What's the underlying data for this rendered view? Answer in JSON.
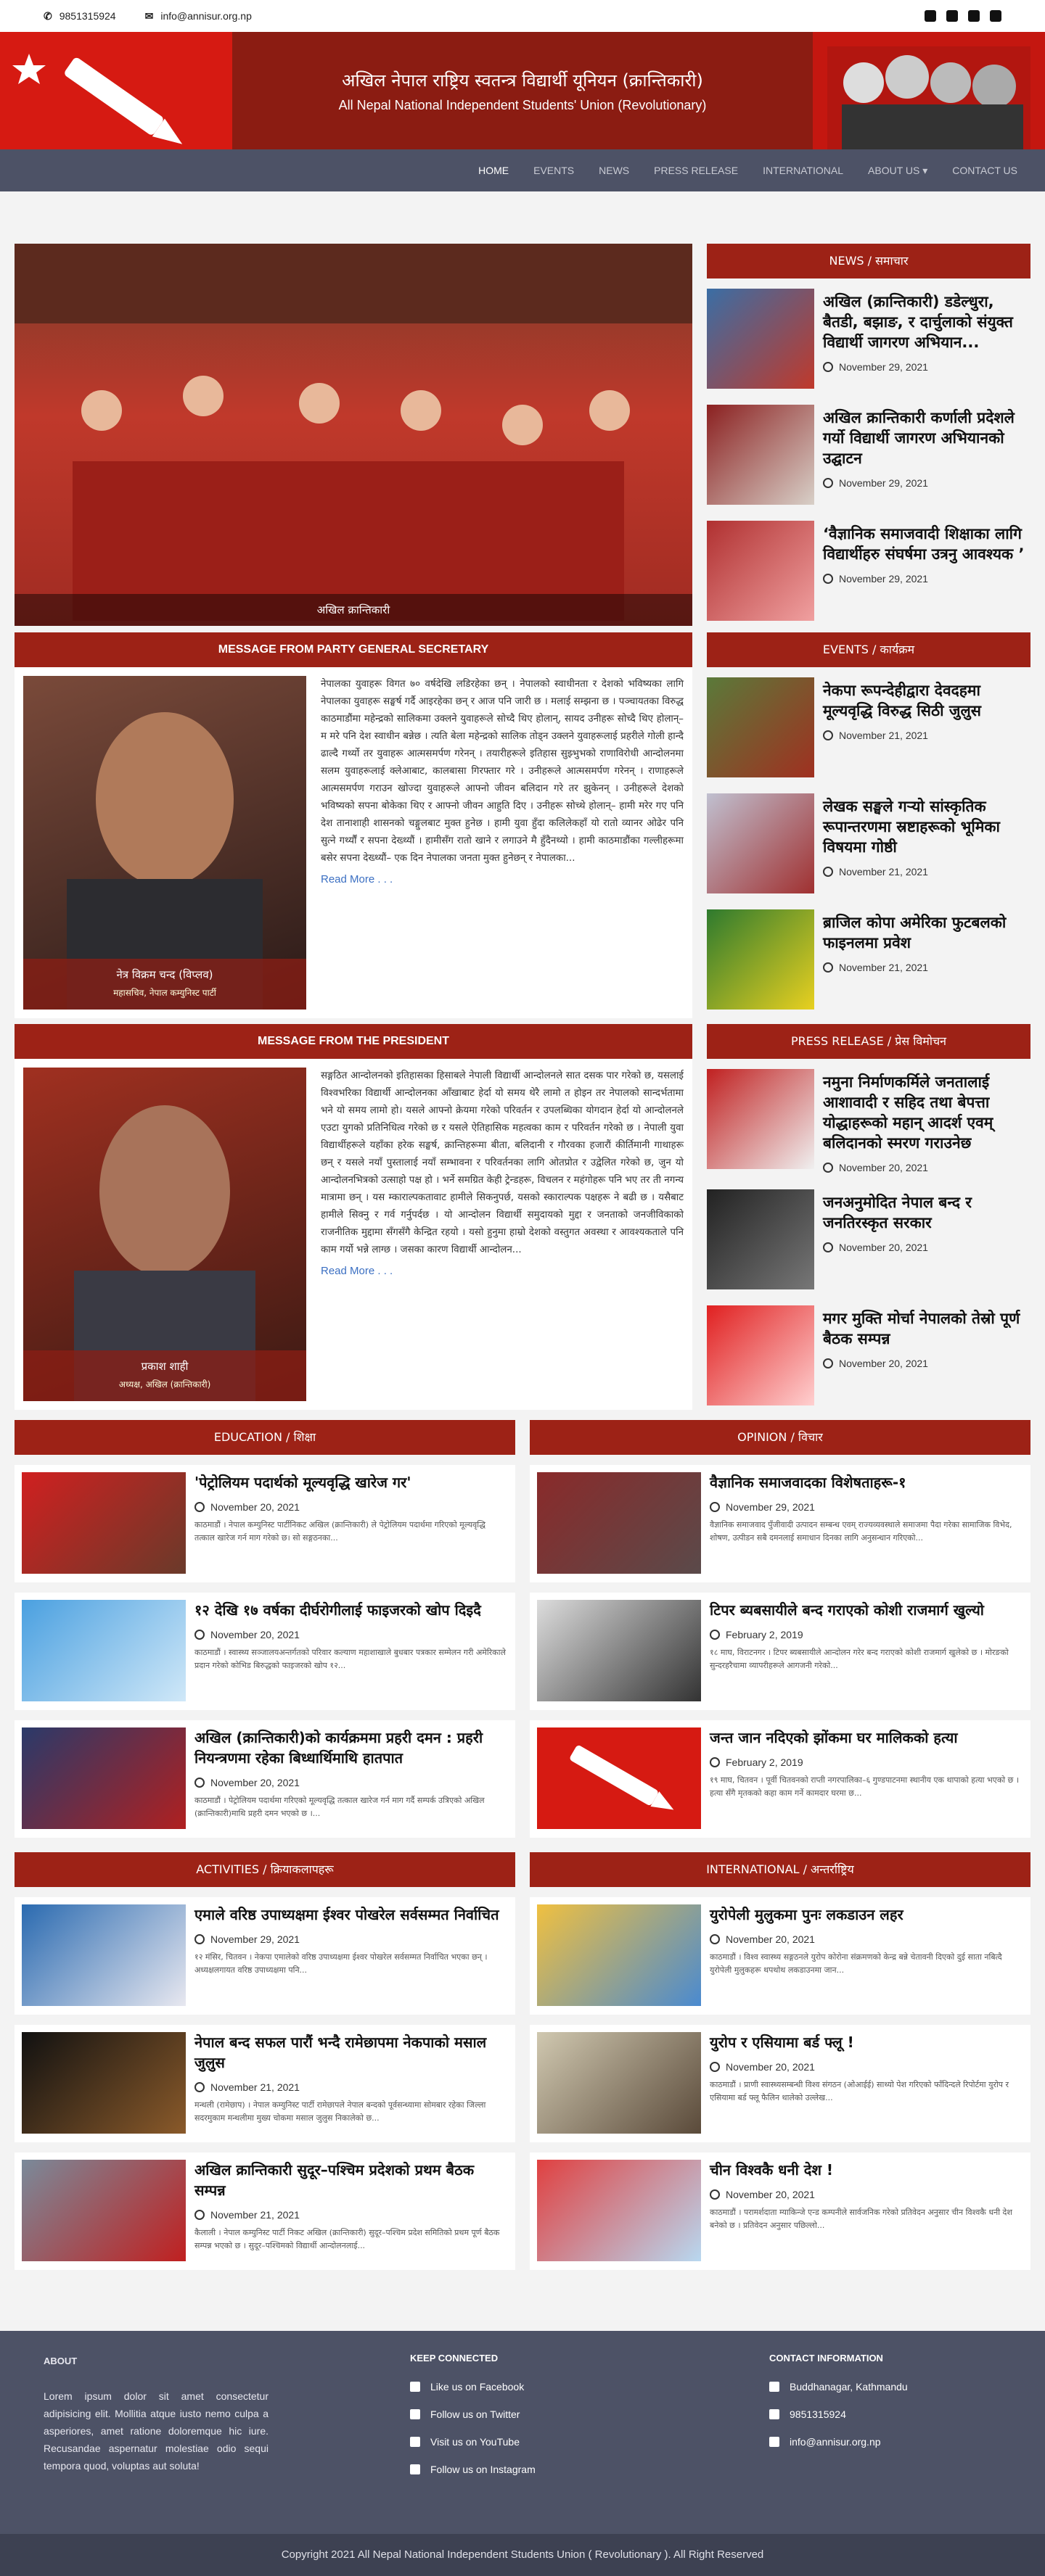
{
  "topbar": {
    "phone": "9851315924",
    "email": "info@annisur.org.np"
  },
  "header": {
    "title_np": "अखिल नेपाल राष्ट्रिय स्वतन्त्र विद्यार्थी यूनियन (क्रान्तिकारी)",
    "title_en": "All Nepal National Independent Students' Union (Revolutionary)"
  },
  "nav": [
    "HOME",
    "EVENTS",
    "NEWS",
    "PRESS RELEASE",
    "INTERNATIONAL",
    "ABOUT US ▾",
    "CONTACT US"
  ],
  "hero": {
    "caption": "अखिल क्रान्तिकारी"
  },
  "news": {
    "title": "NEWS / समाचार",
    "items": [
      {
        "title": "अखिल (क्रान्तिकारी) डडेल्धुरा, बैतडी, बझाङ, र दार्चुलाको संयुक्त विद्यार्थी जागरण अभियान...",
        "date": "November 29, 2021"
      },
      {
        "title": "अखिल क्रान्तिकारी कर्णाली प्रदेशले गर्यो विद्यार्थी जागरण अभियानको उद्घाटन",
        "date": "November 29, 2021"
      },
      {
        "title": "‘वैज्ञानिक समाजवादी शिक्षाका लागि विद्यार्थीहरु संघर्षमा उत्रनु आवश्यक ’",
        "date": "November 29, 2021"
      }
    ]
  },
  "events": {
    "title": "EVENTS / कार्यक्रम",
    "items": [
      {
        "title": "नेकपा रूपन्देहीद्वारा देवदहमा मूल्यवृद्धि विरुद्ध सिठी जुलुस",
        "date": "November 21, 2021"
      },
      {
        "title": "लेखक सङ्घले गर्‍यो सांस्कृतिक रूपान्तरणमा स्रष्टाहरूको भूमिका विषयमा गोष्ठी",
        "date": "November 21, 2021"
      },
      {
        "title": "ब्राजिल कोपा अमेरिका फुटबलको फाइनलमा प्रवेश",
        "date": "November 21, 2021"
      }
    ]
  },
  "press": {
    "title": "PRESS RELEASE / प्रेस विमोचन",
    "items": [
      {
        "title": "नमुना निर्माणकर्मिले जनतालाई आशावादी र सहिद तथा बेपत्ता योद्धाहरूको महान् आदर्श एवम् बलिदानको स्मरण गराउनेछ",
        "date": "November 20, 2021"
      },
      {
        "title": "जनअनुमोदित नेपाल बन्द र जनतिरस्कृत सरकार",
        "date": "November 20, 2021"
      },
      {
        "title": "मगर मुक्ति मोर्चा नेपालको तेस्रो पूर्ण बैठक सम्पन्न",
        "date": "November 20, 2021"
      }
    ]
  },
  "secretary": {
    "title": "MESSAGE FROM PARTY GENERAL SECRETARY",
    "name": "नेत्र विक्रम चन्द (विप्लव)",
    "role": "महासचिव, नेपाल कम्युनिस्ट पार्टी",
    "text": "नेपालका युवाहरू विगत ७० वर्षदेखि लडिरहेका छन् । नेपालको स्वाधीनता र देशको भविष्यका लागि नेपालका युवाहरू सङ्घर्ष गर्दै आइरहेका छन् र आज पनि जारी छ । मलाई सम्झना छ । पञ्चायतका विरुद्ध काठमाडौंमा महेन्द्रको सालिकमा उक्लने युवाहरूले सोच्दै थिए होलान्, सायद उनीहरू सोच्दै थिए होलान्– म मरे पनि देश स्वाधीन बन्नेछ । त्यति बेला महेन्द्रको सालिक तोड्न उक्लने युवाहरूलाई प्रहरीले गोली हान्दै ढाल्दै गर्थ्यो तर युवाहरू आत्मसमर्पण गरेनन् । तयारीहरूले इतिहास सुझ्भुभको राणाविरोधी आन्दोलनमा सलम युवाहरूलाई क्लेआबाट, कालबासा गिरफ्तार गरे । उनीहरूले आत्मसमर्पण गरेनन् । राणाहरूले आत्मसमर्पण गराउन खोज्दा युवाहरूले आफ्नो जीवन बलिदान गरे तर झुकेनन् । उनीहरूले देशको भविष्यको सपना बोकेका थिए र आफ्नो जीवन आहुति दिए । उनीहरू सोच्थे होलान्– हामी मरेर गए पनि देश तानाशाही शासनको चङ्गुलबाट मुक्त हुनेछ । हामी युवा हुँदा कलिलेकहाँ यो रातो व्यानर ओढेर पनि सुत्ने गर्थ्यौं र सपना देख्थ्यौं । हामीसँग रातो खाने र लगाउने मै हुँदैनथ्यो । हामी काठमाडौंका गल्लीहरूमा बसेर सपना देख्थ्यौं– एक दिन नेपालका जनता मुक्त हुनेछन् र नेपालका...",
    "readmore": "Read More . . ."
  },
  "president": {
    "title": "MESSAGE FROM THE PRESIDENT",
    "name": "प्रकाश शाही",
    "role": "अध्यक्ष, अखिल (क्रान्तिकारी)",
    "text": "सङ्गठित आन्दोलनको इतिहासका हिसाबले नेपाली विद्यार्थी आन्दोलनले सात दसक पार गरेको छ, यसलाई विश्वभरिका विद्यार्थी आन्दोलनका आँखाबाट हेर्दा यो समय थेरै लामो त होइन तर नेपालको सान्दर्भतामा भने यो समय लामो हो। यसले आफ्नो क्रेयमा गरेको परिवर्तन र उपलब्धिका योगदान हेर्दा यो आन्दोलनले एउटा युगको प्रतिनिधित्व गरेको छ र यसले ऐतिहासिक महत्वका काम र परिवर्तन गरेको छ । नेपाली युवा विद्यार्थीहरूले यहाँका हरेक सङ्घर्ष, क्रान्तिहरूमा बीता, बलिदानी र गौरवका हजारौं कीर्तिमानी गाथाहरू छन् र यसले नयाँ पुस्तालाई नयाँ सम्भावना र परिवर्तनका लागि ओतप्रोत र उद्वेलित गरेको छ, जुन यो आन्दोलनभित्रको उत्साहो पक्ष हो । भर्ने समग्रित केही ट्रेन्डहरू, विचलन र महंगोहरू पनि भए तर ती नगन्य मात्रामा छन् । यस म्काराल्पकतावाट हामीले सिकनुपर्छ, यसको स्काराल्पक पक्षहरू ने बढी छ । यसैबाट हामीले सिक्नु र गर्व गर्नुपर्दछ । यो आन्दोलन विद्यार्थी समुदायको मुद्दा र जनताको जनजीविकाको राजनीतिक मुद्दामा सँगसँगै केन्द्रित रहयो । यसो हुनुमा हाम्रो देशको वस्तुगत अवस्था र आवश्यकताले पनि काम गर्यो भन्ने लाग्छ । जसका कारण विद्यार्थी आन्दोलन...",
    "readmore": "Read More . . ."
  },
  "education": {
    "title": "EDUCATION / शिक्षा",
    "items": [
      {
        "title": "'पेट्रोलियम पदार्थको मूल्यवृद्धि खारेज गर'",
        "date": "November 20, 2021",
        "text": "काठमाडौं । नेपाल कम्युनिस्ट पार्टीनिकट अखिल (क्रान्तिकारी) ले पेट्रोलियम पदार्थमा गरिएको मूल्यवृद्धि तत्काल खारेज गर्न माग गरेको छ। सो सङ्गठनका..."
      },
      {
        "title": "१२ देखि १७ वर्षका दीर्घरोगीलाई फाइजरको खोप दिइदै",
        "date": "November 20, 2021",
        "text": "काठमाडौं । स्वास्थ्य सञ्जालयअन्तर्गतको परिवार कल्याण महाशाखाले बुधबार पत्रकार सम्मेलन गरी अमेरिकाले प्रदान गरेको कोभिड बिरुद्धको फाइजरको खोप १२..."
      },
      {
        "title": "अखिल (क्रान्तिकारी)को कार्यक्रममा प्रहरी दमन : प्रहरी नियन्त्रणमा रहेका बिध्धार्थिमाथि हातपात",
        "date": "November 20, 2021",
        "text": "काठमाडौं । पेट्रोलियम पदार्थमा गरिएको मूल्यवृद्धि तत्काल खारेज गर्न माग गर्दै सम्पर्क उत्रिएको अखिल (क्रान्तिकारी)माथि प्रहरी दमन भएको छ ।..."
      }
    ]
  },
  "opinion": {
    "title": "OPINION / विचार",
    "items": [
      {
        "title": "वैज्ञानिक समाजवादका विशेषताहरू-१",
        "date": "November 29, 2021",
        "text": "वैज्ञानिक समाजवाद पुँजीवादी उत्पादन सम्बन्ध एवम् राज्यव्यवस्थाले समाजमा पैदा गरेका सामाजिक विभेद, शोषण, उत्पीडन सबै दमनलाई समाधान दिनका लागि अनुसन्धान गरिएको..."
      },
      {
        "title": "टिपर ब्यबसायीले बन्द गराएको कोशी राजमार्ग खुल्यो",
        "date": "February 2, 2019",
        "text": "१८ माघ, विराटनगर । टिपर ब्यबसायीले आन्दोलन गरेर बन्द गराएको कोशी राजमार्ग खुलेको छ । मोरङको सुन्दरहरैचामा व्यापरीहरूले आगजनी गरेको..."
      },
      {
        "title": "जन्त जान नदिएको झोंकमा घर मालिकको हत्या",
        "date": "February 2, 2019",
        "text": "१९ माघ, चितवन । पूर्वी चितवनको राप्ती नगरपालिका–६ गुण्डपाटनमा स्थानीय एक थापाको हत्या भएको छ । हत्या सँगै मृतकको कहा काम गर्ने कामदार घरमा छ..."
      }
    ]
  },
  "activities": {
    "title": "ACTIVITIES / क्रियाकलापहरू",
    "items": [
      {
        "title": "एमाले वरिष्ठ उपाध्यक्षमा ईश्वर पोखरेल सर्वसम्मत निर्वाचित",
        "date": "November 29, 2021",
        "text": "१२ मंसिर, चितवन । नेकपा एमालेको वरिष्ठ उपाध्यक्षमा ईश्वर पोखरेल सर्वसम्मत निर्वाचित भएका छन् । अध्यक्षलगायत वरिष्ठ उपाध्यक्षमा पनि..."
      },
      {
        "title": "नेपाल बन्द सफल पारौं भन्दै रामेछापमा नेकपाको मसाल जुलुस",
        "date": "November 21, 2021",
        "text": "मन्थली (रामेछाप) । नेपाल कम्युनिस्ट पार्टी रामेछापले नेपाल बन्दको पूर्वसन्ध्यामा सोमबार रहेका जिल्ला सदरमुकाम मन्थलीमा मुख्य चोकमा मसाल जुलुस निकालेको छ..."
      },
      {
        "title": "अखिल क्रान्तिकारी सुदूर–पश्चिम प्रदेशको प्रथम बैठक सम्पन्न",
        "date": "November 21, 2021",
        "text": "कैलाली । नेपाल कम्युनिस्ट पार्टी निकट अखिल (क्रान्तिकारी) सुदूर–पश्चिम प्रदेश समितिको प्रथम पूर्ण बैठक सम्पन्न भएको छ । सुदूर–पश्चिमको विद्यार्थी आन्दोलनलाई..."
      }
    ]
  },
  "international": {
    "title": "INTERNATIONAL / अन्तर्राष्ट्रिय",
    "items": [
      {
        "title": "युरोपेली मुलुकमा पुनः लकडाउन लहर",
        "date": "November 20, 2021",
        "text": "काठमाडौं । विश्व स्वास्थ्य सङ्गठनले युरोप कोरोना संक्रमणको केन्द्र बन्ने चेतावनी दिएको दुई साता नबित्दै युरोपेली मुलुकहरू थपथोथ लकडाउनमा जान..."
      },
      {
        "title": "युरोप र एसियामा बर्ड फ्लू !",
        "date": "November 20, 2021",
        "text": "काठमाडौं । प्राणी स्वास्थ्यसम्बन्धी विश्व संगठन (ओआईई) साथ्यो पेश गरिएको फाँदिन्दले रिपोर्टमा युरोप र एसियामा बर्ड फ्लू फैलिन थालेको उल्लेख..."
      },
      {
        "title": "चीन विश्वकै धनी देश !",
        "date": "November 20, 2021",
        "text": "काठमाडौं । परामर्शदाता म्याकिन्जे एन्ड कम्पनीले सार्वजनिक गरेको प्रतिवेदन अनुसार चीन विश्वकै धनी देश बनेको छ । प्रतिवेदन अनुसार पछिल्लो..."
      }
    ]
  },
  "footer": {
    "about_title": "ABOUT",
    "about_text": "Lorem ipsum dolor sit amet consectetur adipisicing elit. Mollitia atque iusto nemo culpa a asperiores, amet ratione doloremque hic iure. Recusandae aspernatur molestiae odio sequi tempora quod, voluptas aut soluta!",
    "keep_title": "KEEP CONNECTED",
    "links": [
      "Like us on Facebook",
      "Follow us on Twitter",
      "Visit us on YouTube",
      "Follow us on Instagram"
    ],
    "contact_title": "CONTACT INFORMATION",
    "address": "Buddhanagar, Kathmandu",
    "phone": "9851315924",
    "email": "info@annisur.org.np",
    "copyright": "Copyright 2021 All Nepal National Independent Students Union ( Revolutionary ). All Right Reserved"
  },
  "colors": {
    "brand_red": "#9d2216",
    "header_dark": "#8b1c12",
    "nav": "#4d5266"
  }
}
